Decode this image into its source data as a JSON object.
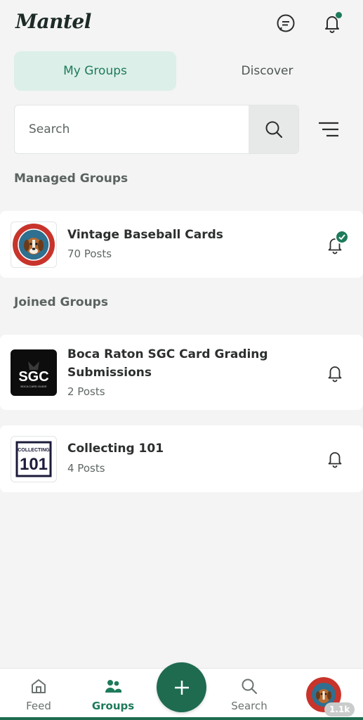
{
  "app": {
    "logo": "Mantel"
  },
  "header": {
    "chat_icon": "chat-icon",
    "bell_icon": "bell-icon",
    "has_notification": true
  },
  "tabs": [
    {
      "label": "My Groups",
      "active": true
    },
    {
      "label": "Discover",
      "active": false
    }
  ],
  "search": {
    "placeholder": "Search",
    "value": ""
  },
  "sections": {
    "managed": "Managed Groups",
    "joined": "Joined Groups"
  },
  "managed_groups": [
    {
      "name": "Vintage Baseball Cards",
      "posts": "70 Posts",
      "thumb_text_top": "CARDHOUND",
      "thumb_text_bottom": "VINTAGE",
      "notifications_on": true
    }
  ],
  "joined_groups": [
    {
      "name": "Boca Raton SGC Card Grading Submissions",
      "posts": "2 Posts",
      "thumb_text": "SGC",
      "thumb_subtext": "BOCA CARD GUIDE",
      "notifications_on": false
    },
    {
      "name": "Collecting 101",
      "posts": "4 Posts",
      "thumb_text_top": "COLLECTING",
      "thumb_text": "101",
      "notifications_on": false
    }
  ],
  "bottom_nav": [
    {
      "label": "Feed",
      "icon": "home-icon",
      "active": false
    },
    {
      "label": "Groups",
      "icon": "groups-icon",
      "active": true
    },
    {
      "label": "Search",
      "icon": "search-icon",
      "active": false
    }
  ],
  "profile": {
    "badge": "1.1k"
  },
  "colors": {
    "accent": "#1e7a5c",
    "tab_active_bg": "#dcefe9",
    "fab": "#1e6b50"
  }
}
